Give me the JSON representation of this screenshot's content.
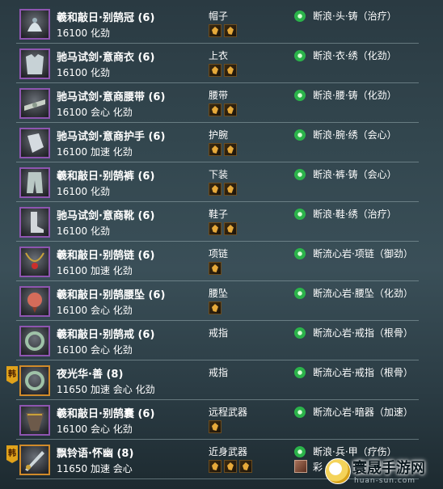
{
  "colors": {
    "purple_border": "#8e55b0",
    "orange_border": "#d08a2a",
    "enchant_green": "#2bb34a",
    "badge_gold": "#e0a21b"
  },
  "rows": [
    {
      "name": "羲和敲日·别鹄冠 (6)",
      "stats": "16100 化劲",
      "slot": "帽子",
      "runes": 2,
      "enchant": "断浪·头·铸（治疗）",
      "icon": "hat-icon",
      "quality": "purple"
    },
    {
      "name": "驰马试剑·意商衣 (6)",
      "stats": "16100 化劲",
      "slot": "上衣",
      "runes": 2,
      "enchant": "断浪·衣·绣（化劲）",
      "icon": "robe-icon",
      "quality": "purple"
    },
    {
      "name": "驰马试剑·意商腰带 (6)",
      "stats": "16100 会心 化劲",
      "slot": "腰带",
      "runes": 2,
      "enchant": "断浪·腰·铸（化劲）",
      "icon": "belt-icon",
      "quality": "purple"
    },
    {
      "name": "驰马试剑·意商护手 (6)",
      "stats": "16100 加速 化劲",
      "slot": "护腕",
      "runes": 2,
      "enchant": "断浪·腕·绣（会心）",
      "icon": "bracer-icon",
      "quality": "purple"
    },
    {
      "name": "羲和敲日·别鹄裤 (6)",
      "stats": "16100 化劲",
      "slot": "下装",
      "runes": 2,
      "enchant": "断浪·裤·铸（会心）",
      "icon": "pants-icon",
      "quality": "purple"
    },
    {
      "name": "驰马试剑·意商靴 (6)",
      "stats": "16100 化劲",
      "slot": "鞋子",
      "runes": 2,
      "enchant": "断浪·鞋·绣（治疗）",
      "icon": "boots-icon",
      "quality": "purple"
    },
    {
      "name": "羲和敲日·别鹄链 (6)",
      "stats": "16100 加速 化劲",
      "slot": "项链",
      "runes": 1,
      "enchant": "断流心岩·项链（御劲）",
      "icon": "necklace-icon",
      "quality": "purple"
    },
    {
      "name": "羲和敲日·别鹄腰坠 (6)",
      "stats": "16100 会心 化劲",
      "slot": "腰坠",
      "runes": 1,
      "enchant": "断流心岩·腰坠（化劲）",
      "icon": "pendant-icon",
      "quality": "purple"
    },
    {
      "name": "羲和敲日·别鹄戒 (6)",
      "stats": "16100 会心 化劲",
      "slot": "戒指",
      "runes": 0,
      "enchant": "断流心岩·戒指（根骨）",
      "icon": "ring-icon",
      "quality": "purple"
    },
    {
      "name": "夜光华·善 (8)",
      "stats": "11650 加速 会心 化劲",
      "slot": "戒指",
      "runes": 0,
      "enchant": "断流心岩·戒指（根骨）",
      "icon": "ring-icon",
      "quality": "orange",
      "badge": "韩"
    },
    {
      "name": "羲和敲日·别鹄囊 (6)",
      "stats": "16100 会心 化劲",
      "slot": "远程武器",
      "runes": 1,
      "enchant": "断流心岩·暗器（加速）",
      "icon": "quiver-icon",
      "quality": "purple"
    },
    {
      "name": "飘铃语·怀幽 (8)",
      "stats": "11650 加速 会心",
      "slot": "近身武器",
      "runes": 3,
      "enchant": "断浪·兵·甲（疗伤）",
      "enchant2": "彩",
      "icon": "weapon-icon",
      "quality": "orange",
      "badge": "韩"
    }
  ],
  "watermark": {
    "text": "寰晟手游网",
    "sub": "huan-sun.com"
  }
}
